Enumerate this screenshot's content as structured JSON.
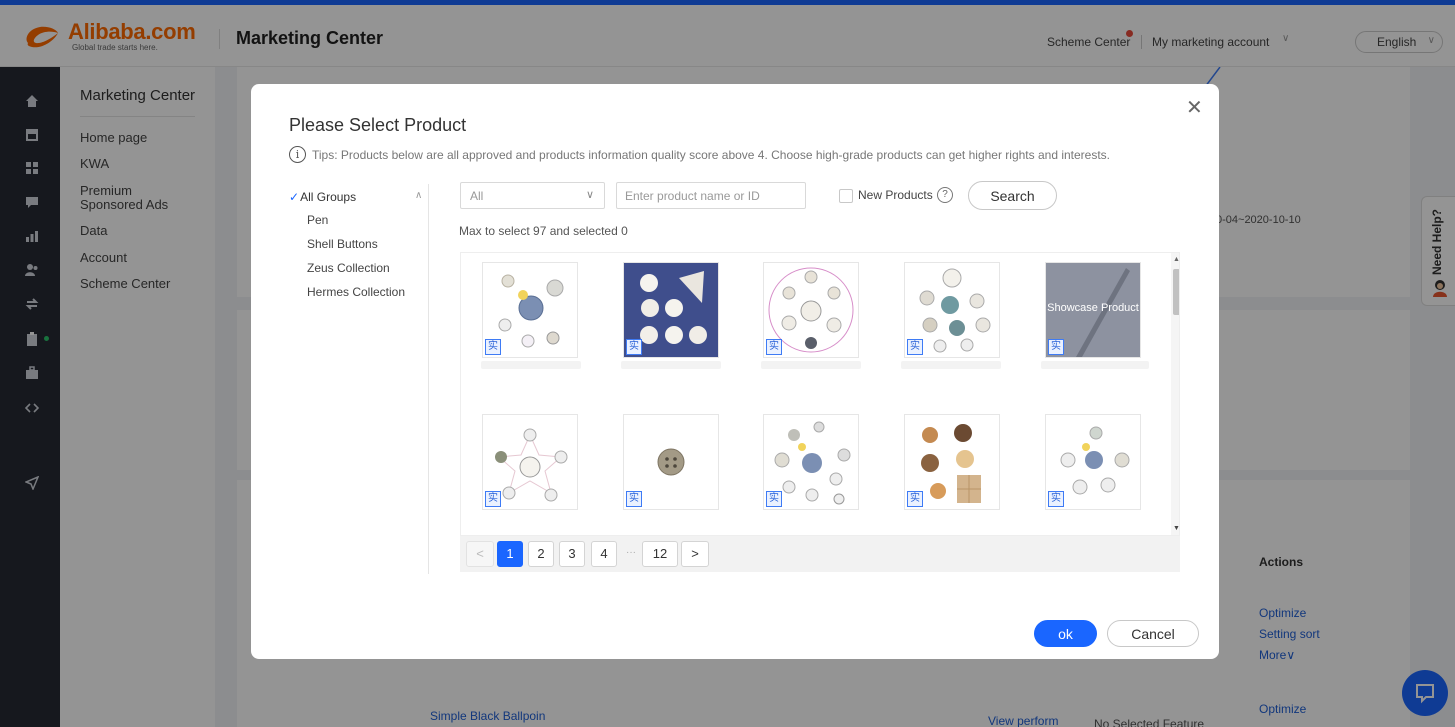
{
  "header": {
    "logo_name": "Alibaba.com",
    "logo_tagline": "Global trade starts here.",
    "app_title": "Marketing Center",
    "scheme_center": "Scheme Center",
    "account": "My marketing account",
    "language": "English"
  },
  "sidebar": {
    "rail_icons": [
      "home-icon",
      "store-icon",
      "grid-icon",
      "message-icon",
      "bar-chart-icon",
      "users-icon",
      "transfer-icon",
      "clipboard-icon",
      "briefcase-icon",
      "code-icon",
      "send-icon"
    ],
    "title": "Marketing Center",
    "items": [
      "Home page",
      "KWA",
      "Premium Sponsored Ads",
      "Data",
      "Account",
      "Scheme Center"
    ]
  },
  "background": {
    "date_range": "0-04~2020-10-10",
    "actions_header": "Actions",
    "row1_actions": [
      "Optimize",
      "Setting sort",
      "More∨"
    ],
    "row2_product": "Simple Black Ballpoin",
    "row2_view": "View perform",
    "row2_feature": "No Selected Feature",
    "row2_action": "Optimize",
    "need_help": "Need Help?"
  },
  "modal": {
    "title": "Please Select Product",
    "tip": "Tips: Products below are all approved and products information quality score above 4. Choose high-grade products can get higher rights and interests.",
    "groups": {
      "all_label": "All Groups",
      "items": [
        "Pen",
        "Shell Buttons",
        "Zeus Collection",
        "Hermes Collection"
      ]
    },
    "filter": {
      "select_value": "All",
      "search_placeholder": "Enter product name or ID",
      "new_products_label": "New Products",
      "new_products_checked": false,
      "search_button": "Search"
    },
    "max_text": "Max to select 97 and selected 0",
    "badge_text": "实",
    "showcase_label": "Showcase Product",
    "pagination": {
      "prev": "<",
      "pages": [
        "1",
        "2",
        "3",
        "4"
      ],
      "ellipsis": "···",
      "last": "12",
      "next": ">",
      "current": "1"
    },
    "ok_button": "ok",
    "cancel_button": "Cancel"
  },
  "colors": {
    "primary": "#1a66ff",
    "brand_orange": "#ff6a00",
    "sidebar_dark": "#262a34",
    "status_green": "#2bc46b"
  }
}
